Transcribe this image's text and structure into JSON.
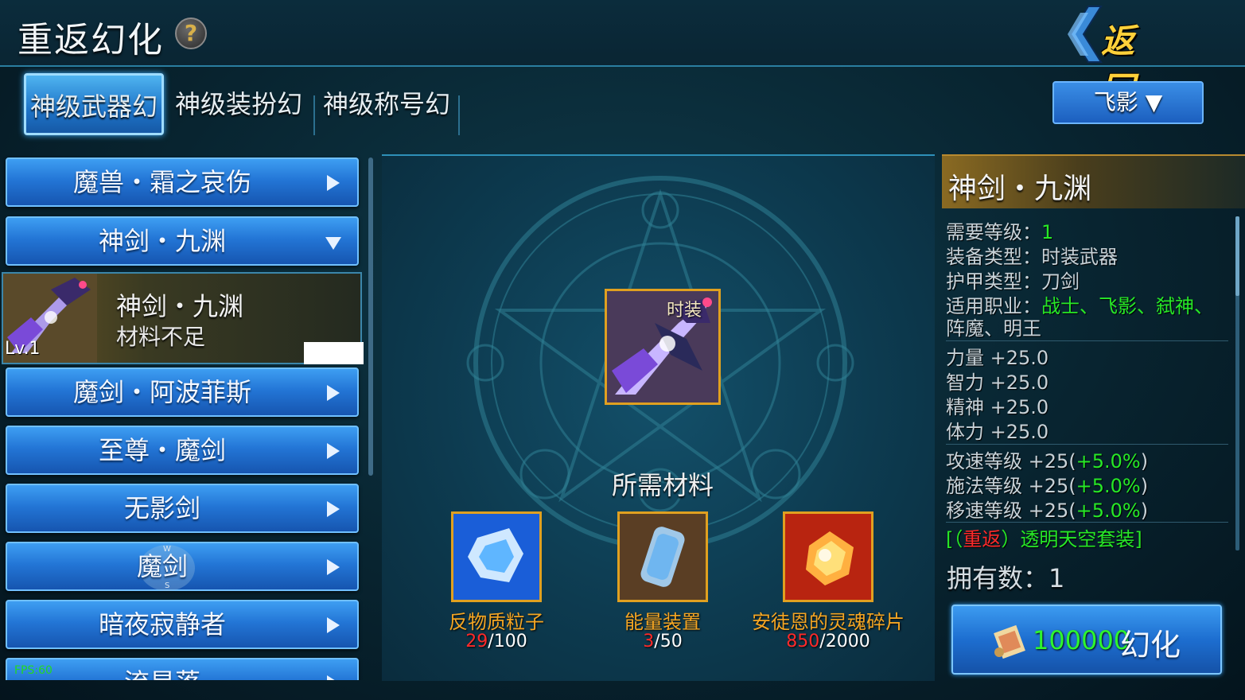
{
  "header": {
    "title": "重返幻化",
    "help_icon": "?",
    "back_label": "返回"
  },
  "tabs": [
    {
      "label": "神级武器幻",
      "active": true
    },
    {
      "label": "神级装扮幻",
      "active": false
    },
    {
      "label": "神级称号幻",
      "active": false
    }
  ],
  "class_selector": {
    "value": "飞影",
    "icon": "triangle-down"
  },
  "weapon_list": {
    "items": [
      {
        "label": "魔兽・霜之哀伤",
        "expanded": false
      },
      {
        "label": "神剑・九渊",
        "expanded": true
      },
      {
        "label": "魔剑・阿波菲斯",
        "expanded": false
      },
      {
        "label": "至尊・魔剑",
        "expanded": false
      },
      {
        "label": "无影剑",
        "expanded": false
      },
      {
        "label": "魔剑",
        "expanded": false
      },
      {
        "label": "暗夜寂静者",
        "expanded": false
      },
      {
        "label": "流星落",
        "expanded": false
      }
    ],
    "selected_sub": {
      "name": "神剑・九渊",
      "status": "材料不足",
      "level": "Lv.1"
    },
    "badge_letters": {
      "top": "W",
      "bottom": "S"
    }
  },
  "fps": "FPS:60",
  "center": {
    "weapon_tag": "时装",
    "materials_title": "所需材料",
    "materials": [
      {
        "name": "反物质粒子",
        "owned": "29",
        "required": "/100",
        "color": "#1e6fe8"
      },
      {
        "name": "能量装置",
        "owned": "3",
        "required": "/50",
        "color": "#6a4a2a"
      },
      {
        "name": "安徒恩的灵魂碎片",
        "owned": "850",
        "required": "/2000",
        "color": "#c82a10"
      }
    ]
  },
  "info": {
    "title": "神剑・九渊",
    "req_level_label": "需要等级：",
    "req_level_value": "1",
    "equip_type_label": "装备类型：",
    "equip_type_value": "时装武器",
    "armor_type_label": "护甲类型：",
    "armor_type_value": "刀剑",
    "job_label": "适用职业：",
    "job_line1": "战士、飞影、弑神、",
    "job_line2": "阵魔、明王",
    "stats": [
      {
        "name": "力量",
        "value": "+25.0"
      },
      {
        "name": "智力",
        "value": "+25.0"
      },
      {
        "name": "精神",
        "value": "+25.0"
      },
      {
        "name": "体力",
        "value": "+25.0"
      }
    ],
    "speed_stats": [
      {
        "name": "攻速等级",
        "value": "+25(",
        "pct": "+5.0%",
        "close": ")"
      },
      {
        "name": "施法等级",
        "value": "+25(",
        "pct": "+5.0%",
        "close": ")"
      },
      {
        "name": "移速等级",
        "value": "+25(",
        "pct": "+5.0%",
        "close": ")"
      }
    ],
    "set_prefix": "[（",
    "set_tag": "重返",
    "set_suffix": "）透明天空套装]",
    "own_label": "拥有数：",
    "own_value": "1"
  },
  "transform_button": {
    "cost": "100000",
    "label": "幻化"
  },
  "colors": {
    "accent_blue": "#2376d6",
    "gold_border": "#e0a020",
    "green": "#27e827",
    "red": "#ff2a2a"
  }
}
